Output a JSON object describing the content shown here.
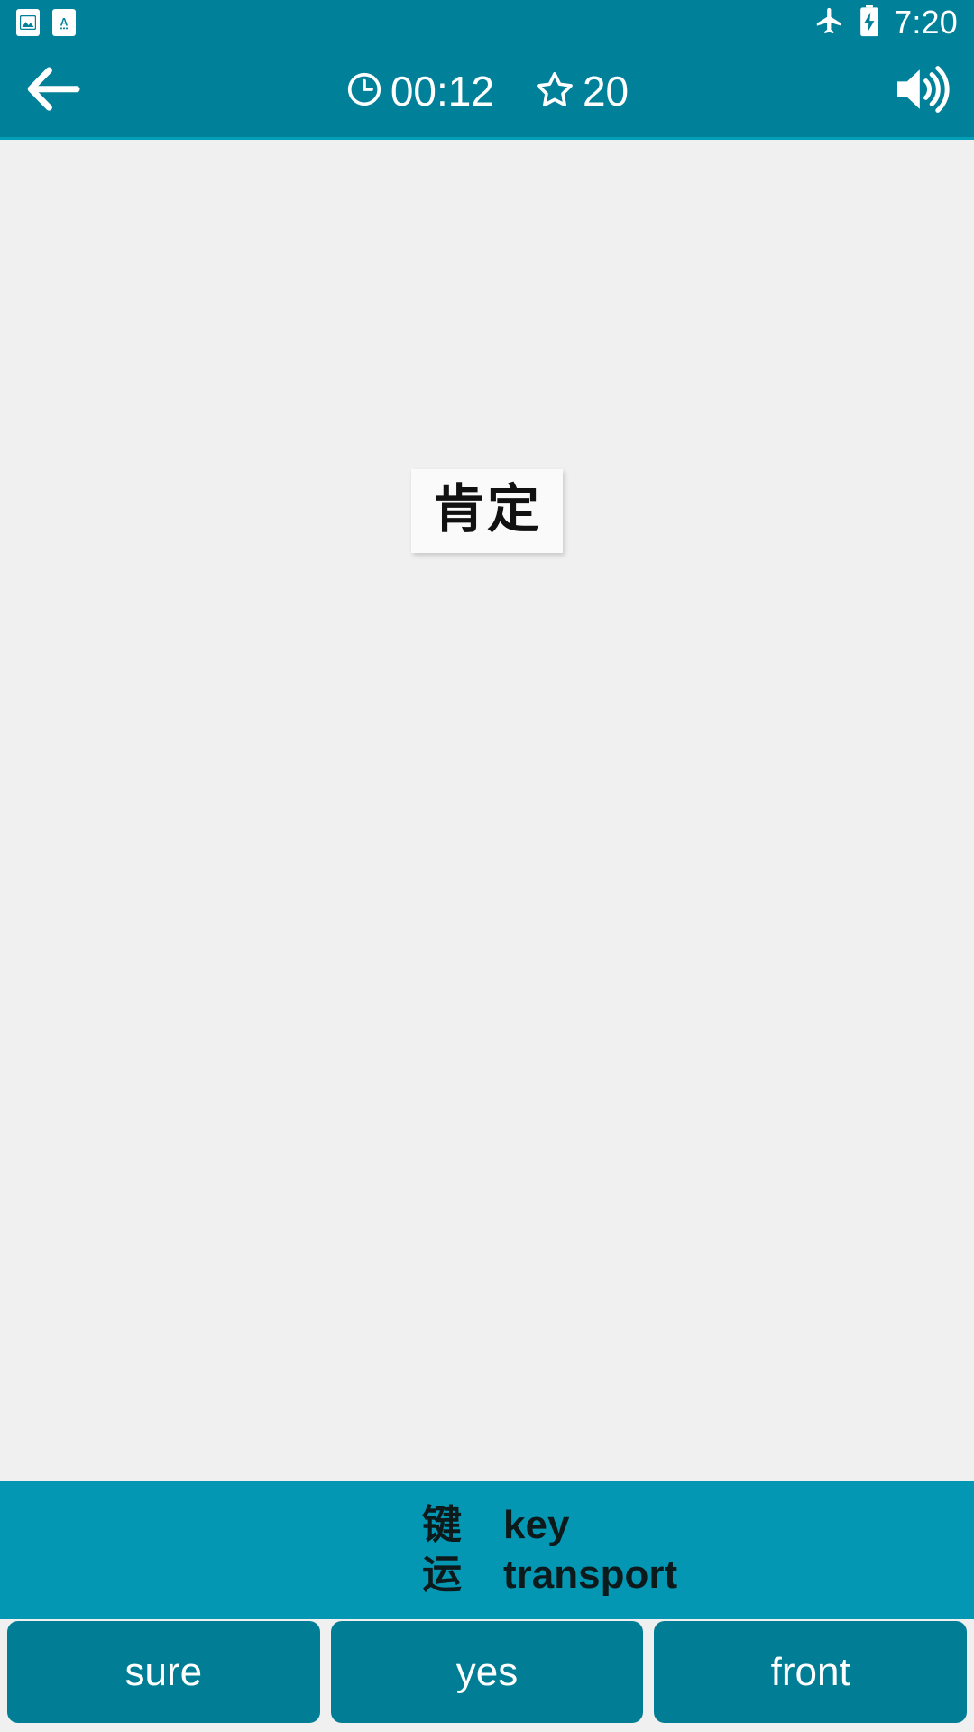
{
  "status_bar": {
    "notifications": [
      {
        "icon": "image-notification-icon",
        "name": "image"
      },
      {
        "icon": "text-notification-icon",
        "name": "A"
      }
    ],
    "airplane_icon": "airplane-mode-icon",
    "battery_icon": "battery-charging-icon",
    "time": "7:20",
    "background_color": "#018099"
  },
  "app_bar": {
    "back_icon": "back-arrow-icon",
    "timer": {
      "icon": "clock-icon",
      "value": "00:12"
    },
    "score": {
      "icon": "star-outline-icon",
      "value": "20"
    },
    "sound_icon": "speaker-volume-icon",
    "background_color": "#018099",
    "accent_color": "#029FB8"
  },
  "content": {
    "background_color": "#F0F0F0",
    "word_card": {
      "text": "肯定",
      "background_color": "#FAFAFA",
      "text_color": "#111111"
    }
  },
  "hint_panel": {
    "background_color": "#0497B3",
    "text_color": "#0D1A1C",
    "rows": [
      {
        "hanzi": "键",
        "english": "key"
      },
      {
        "hanzi": "运",
        "english": "transport"
      }
    ]
  },
  "answers": {
    "button_color": "#017E95",
    "text_color": "#FFFFFF",
    "options": [
      {
        "label": "sure"
      },
      {
        "label": "yes"
      },
      {
        "label": "front"
      }
    ]
  }
}
